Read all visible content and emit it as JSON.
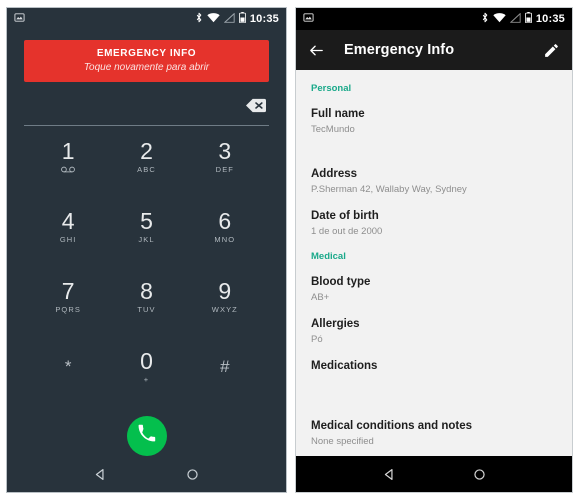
{
  "left_phone": {
    "statusbar": {
      "notification_icon": "screenshot-icon",
      "bluetooth_icon": "bluetooth-icon",
      "wifi_icon": "wifi-icon",
      "signal_icon": "signal-icon",
      "battery_icon": "battery-icon",
      "time": "10:35"
    },
    "emergency_banner": {
      "title": "EMERGENCY INFO",
      "subtitle": "Toque novamente para abrir",
      "background_color": "#e5332c"
    },
    "number_entry": {
      "value": "",
      "backspace_icon": "backspace-icon"
    },
    "dialpad": {
      "keys": [
        {
          "digit": "1",
          "sub": "",
          "icon": "voicemail-icon"
        },
        {
          "digit": "2",
          "sub": "ABC",
          "icon": ""
        },
        {
          "digit": "3",
          "sub": "DEF",
          "icon": ""
        },
        {
          "digit": "4",
          "sub": "GHI",
          "icon": ""
        },
        {
          "digit": "5",
          "sub": "JKL",
          "icon": ""
        },
        {
          "digit": "6",
          "sub": "MNO",
          "icon": ""
        },
        {
          "digit": "7",
          "sub": "PQRS",
          "icon": ""
        },
        {
          "digit": "8",
          "sub": "TUV",
          "icon": ""
        },
        {
          "digit": "9",
          "sub": "WXYZ",
          "icon": ""
        },
        {
          "digit": "*",
          "sub": "",
          "icon": ""
        },
        {
          "digit": "0",
          "sub": "+",
          "icon": ""
        },
        {
          "digit": "#",
          "sub": "",
          "icon": ""
        }
      ]
    },
    "call_button": {
      "icon": "phone-icon",
      "color": "#04bf4d"
    },
    "navbar": {
      "back_icon": "back-triangle-icon",
      "home_icon": "home-circle-icon"
    }
  },
  "right_phone": {
    "statusbar": {
      "notification_icon": "screenshot-icon",
      "bluetooth_icon": "bluetooth-icon",
      "wifi_icon": "wifi-icon",
      "signal_icon": "signal-icon",
      "battery_icon": "battery-icon",
      "time": "10:35"
    },
    "appbar": {
      "back_icon": "arrow-back-icon",
      "title": "Emergency Info",
      "edit_icon": "pencil-icon"
    },
    "sections": [
      {
        "heading": "Personal",
        "accent_color": "#1aa98a",
        "fields": [
          {
            "label": "Full name",
            "value": "TecMundo"
          },
          {
            "label": "Address",
            "value": "P.Sherman 42, Wallaby Way, Sydney"
          },
          {
            "label": "Date of birth",
            "value": "1 de out de 2000"
          }
        ]
      },
      {
        "heading": "Medical",
        "accent_color": "#1aa98a",
        "fields": [
          {
            "label": "Blood type",
            "value": "AB+"
          },
          {
            "label": "Allergies",
            "value": "Pó"
          },
          {
            "label": "Medications",
            "value": ""
          },
          {
            "label": "Medical conditions and notes",
            "value": "None specified"
          }
        ]
      }
    ],
    "navbar": {
      "back_icon": "back-triangle-icon",
      "home_icon": "home-circle-icon"
    }
  }
}
